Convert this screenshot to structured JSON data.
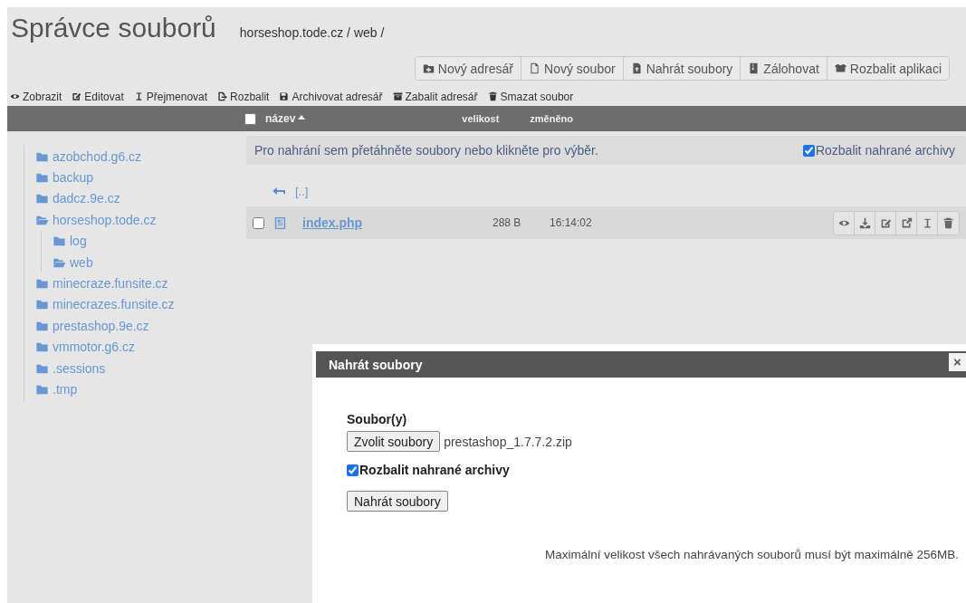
{
  "title": "Správce souborů",
  "breadcrumb": "horseshop.tode.cz / web /",
  "buttons": [
    "Nový adresář",
    "Nový soubor",
    "Nahrát soubory",
    "Zálohovat",
    "Rozbalit aplikaci"
  ],
  "actions": [
    "Zobrazit",
    "Editovat",
    "Přejmenovat",
    "Rozbalit",
    "Archivovat adresář",
    "Zabalit adresář",
    "Smazat soubor"
  ],
  "table": {
    "select_all": {
      "checked": false
    },
    "columns": [
      "název",
      "velikost",
      "změněno"
    ]
  },
  "tree": [
    {
      "label": "azobchod.g6.cz",
      "open": false
    },
    {
      "label": "backup",
      "open": false
    },
    {
      "label": "dadcz.9e.cz",
      "open": false
    },
    {
      "label": "horseshop.tode.cz",
      "open": true,
      "children": [
        {
          "label": "log",
          "open": false
        },
        {
          "label": "web",
          "open": true
        }
      ]
    },
    {
      "label": "minecraze.funsite.cz",
      "open": false
    },
    {
      "label": "minecrazes.funsite.cz",
      "open": false
    },
    {
      "label": "prestashop.9e.cz",
      "open": false
    },
    {
      "label": "vmmotor.g6.cz",
      "open": false
    },
    {
      "label": ".sessions",
      "open": false
    },
    {
      "label": ".tmp",
      "open": false
    }
  ],
  "dropzone": {
    "text": "Pro nahrání sem přetáhněte soubory nebo klikněte pro výběr.",
    "extract": {
      "label": "Rozbalit nahrané archivy",
      "checked": true
    }
  },
  "parent_link": "[..]",
  "files": [
    {
      "name": "index.php",
      "size": "288 B",
      "modified": "16:14:02",
      "checked": false
    }
  ],
  "dialog": {
    "title": "Nahrát soubory",
    "close": "×",
    "field_label": "Soubor(y)",
    "choose_button": "Zvolit soubory",
    "file_name": "prestashop_1.7.7.2.zip",
    "extract": {
      "label": "Rozbalit nahrané archivy",
      "checked": true
    },
    "submit": "Nahrát soubory",
    "note": "Maximální velikost všech nahrávaných souborů musí být maximálně 256MB."
  }
}
